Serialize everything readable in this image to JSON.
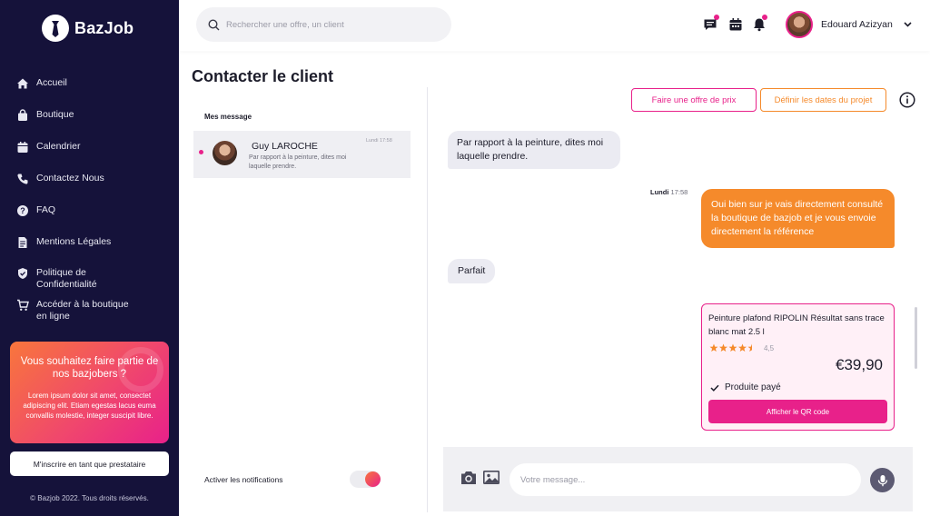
{
  "brand": {
    "name": "BazJob"
  },
  "sidebar": {
    "items": [
      {
        "label": "Accueil",
        "icon": "home-icon"
      },
      {
        "label": "Boutique",
        "icon": "shopping-bag-icon"
      },
      {
        "label": "Calendrier",
        "icon": "calendar-icon"
      },
      {
        "label": "Contactez Nous",
        "icon": "phone-icon"
      },
      {
        "label": "FAQ",
        "icon": "help-icon"
      },
      {
        "label": "Mentions Légales",
        "icon": "document-icon"
      },
      {
        "label": "Politique de Confidentialité",
        "icon": "shield-icon"
      },
      {
        "label": "Accéder à la boutique en ligne",
        "icon": "cart-icon"
      }
    ],
    "promo": {
      "title": "Vous souhaitez faire partie de nos bazjobers ?",
      "text": "Lorem ipsum dolor sit amet, consectet adipiscing elit. Etiam egestas lacus euma convallis molestie, integer suscipit libre."
    },
    "signup_label": "M'inscrire en tant que prestataire",
    "copyright": "© Bazjob 2022. Tous droits réservés."
  },
  "header": {
    "search_placeholder": "Rechercher une offre, un client",
    "user_name": "Edouard Azizyan"
  },
  "page": {
    "title": "Contacter le client"
  },
  "conversations": {
    "heading": "Mes message",
    "items": [
      {
        "name": "Guy LAROCHE",
        "time": "Lundi 17:58",
        "preview": "Par rapport à la peinture, dites moi laquelle prendre."
      }
    ],
    "notifications_label": "Activer les notifications"
  },
  "actions": {
    "offer_label": "Faire une offre de prix",
    "dates_label": "Définir les dates du projet"
  },
  "chat": {
    "messages": [
      {
        "from": "client",
        "text": "Par rapport à la peinture, dites moi laquelle prendre."
      },
      {
        "from": "me",
        "text": "Oui bien sur je vais directement consulté la boutique de bazjob et je vous envoie directement la référence"
      },
      {
        "from": "client",
        "text": "Parfait"
      }
    ],
    "time_day": "Lundi",
    "time_hour": "17:58",
    "product": {
      "name": "Peinture plafond RIPOLIN Résultat sans trace blanc mat 2.5 l",
      "rating": "4,5",
      "price": "€39,90",
      "status": "Produite payé",
      "qr_label": "Afficher le QR code"
    },
    "input_placeholder": "Votre message..."
  },
  "colors": {
    "sidebar_bg": "#15123a",
    "accent_pink": "#e8218a",
    "accent_orange": "#f58a2b"
  }
}
